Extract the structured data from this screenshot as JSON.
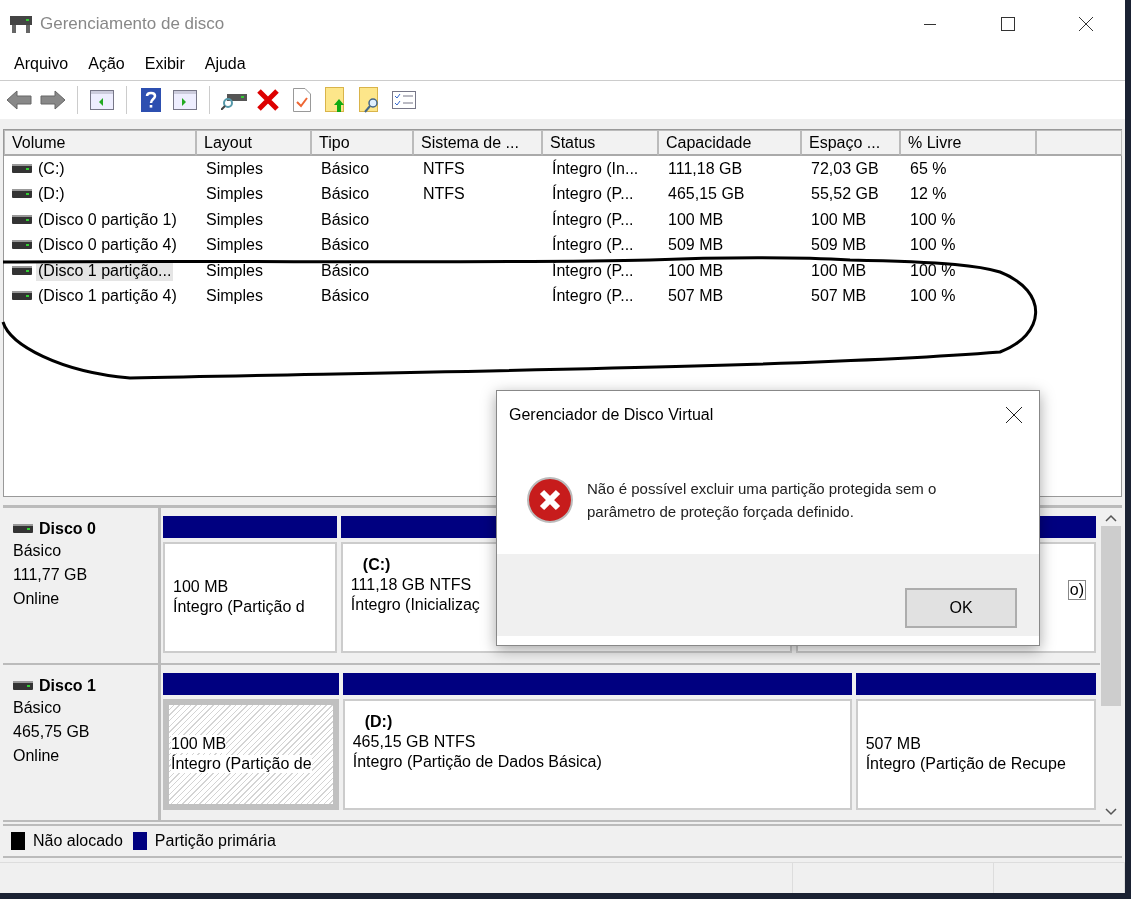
{
  "window": {
    "title": "Gerenciamento de disco"
  },
  "menu": [
    "Arquivo",
    "Ação",
    "Exibir",
    "Ajuda"
  ],
  "volume_table": {
    "columns": [
      "Volume",
      "Layout",
      "Tipo",
      "Sistema de ...",
      "Status",
      "Capacidade",
      "Espaço ...",
      "% Livre"
    ],
    "rows": [
      {
        "cells": [
          "(C:)",
          "Simples",
          "Básico",
          "NTFS",
          "Íntegro (In...",
          "111,18 GB",
          "72,03 GB",
          "65 %"
        ],
        "selected": false
      },
      {
        "cells": [
          "(D:)",
          "Simples",
          "Básico",
          "NTFS",
          "Íntegro (P...",
          "465,15 GB",
          "55,52 GB",
          "12 %"
        ],
        "selected": false
      },
      {
        "cells": [
          "(Disco 0 partição 1)",
          "Simples",
          "Básico",
          null,
          "Íntegro (P...",
          "100 MB",
          "100 MB",
          "100 %"
        ],
        "selected": false
      },
      {
        "cells": [
          "(Disco 0 partição 4)",
          "Simples",
          "Básico",
          null,
          "Íntegro (P...",
          "509 MB",
          "509 MB",
          "100 %"
        ],
        "selected": false
      },
      {
        "cells": [
          "(Disco 1 partição...",
          "Simples",
          "Básico",
          null,
          "Íntegro (P...",
          "100 MB",
          "100 MB",
          "100 %"
        ],
        "selected": true
      },
      {
        "cells": [
          "(Disco 1 partição 4)",
          "Simples",
          "Básico",
          null,
          "Íntegro (P...",
          "507 MB",
          "507 MB",
          "100 %"
        ],
        "selected": false
      }
    ]
  },
  "disks": [
    {
      "name": "Disco 0",
      "type": "Básico",
      "size": "111,77 GB",
      "state": "Online",
      "partitions": [
        {
          "size": "100 MB",
          "status": "Íntegro (Partição d",
          "selected": false
        },
        {
          "label": "(C:)",
          "size": "111,18 GB NTFS",
          "status": "Íntegro (Inicializaç",
          "selected": false
        },
        {
          "status": "o)",
          "selected": false
        }
      ]
    },
    {
      "name": "Disco 1",
      "type": "Básico",
      "size": "465,75 GB",
      "state": "Online",
      "partitions": [
        {
          "size": "100 MB",
          "status": "Íntegro (Partição de",
          "selected": true
        },
        {
          "label": "(D:)",
          "size": "465,15 GB NTFS",
          "status": "Íntegro (Partição de Dados Básica)",
          "selected": false
        },
        {
          "size": "507 MB",
          "status": "Íntegro (Partição de Recupe",
          "selected": false
        }
      ]
    }
  ],
  "legend": [
    {
      "label": "Não alocado",
      "color": "#000000"
    },
    {
      "label": "Partição primária",
      "color": "#000080"
    }
  ],
  "dialog": {
    "title": "Gerenciador de Disco Virtual",
    "message": "Não é possível excluir uma partição protegida sem o parâmetro de proteção forçada definido.",
    "button": "OK"
  }
}
